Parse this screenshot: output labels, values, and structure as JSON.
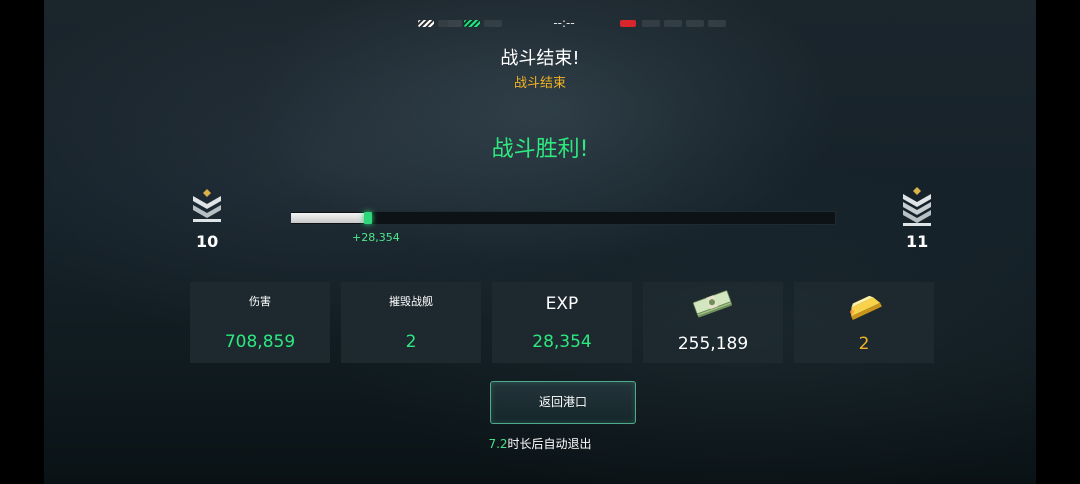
{
  "top": {
    "timer": "--:--",
    "flags": [
      {
        "name": "team-flag-1",
        "color": "white"
      },
      {
        "name": "team-flag-2",
        "color": "green"
      },
      {
        "name": "enemy-flag-1",
        "color": "red"
      }
    ]
  },
  "header": {
    "title": "战斗结束!",
    "subtitle": "战斗结束"
  },
  "result": {
    "text": "战斗胜利!"
  },
  "rank": {
    "current_level": "10",
    "next_level": "11",
    "progress_before": 0.135,
    "progress_after": 0.15,
    "gain_text": "+28,354"
  },
  "stats": [
    {
      "label": "伤害",
      "value": "708,859",
      "color": "#2ee880"
    },
    {
      "label": "摧毁战舰",
      "value": "2",
      "color": "#2ee880"
    },
    {
      "label": "EXP",
      "value": "28,354",
      "color": "#2ee880"
    },
    {
      "icon": "cash-icon",
      "value": "255,189",
      "color": "#ffffff"
    },
    {
      "icon": "gold-bar-icon",
      "value": "2",
      "color": "#f3b322"
    }
  ],
  "actions": {
    "return_label": "返回港口"
  },
  "auto_exit": {
    "seconds": "7.2",
    "text": "时长后自动退出"
  },
  "colors": {
    "accent_green": "#2ee880",
    "gold": "#f3b322"
  }
}
